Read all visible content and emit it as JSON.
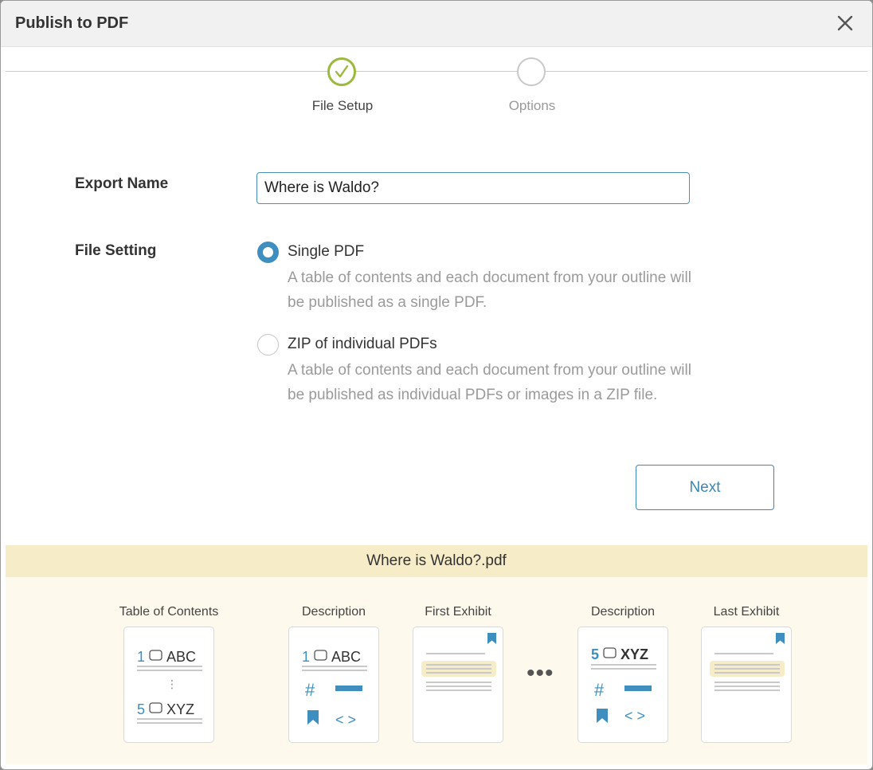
{
  "dialog": {
    "title": "Publish to PDF",
    "close_icon": "close-icon"
  },
  "stepper": {
    "steps": [
      {
        "label": "File Setup",
        "state": "completed"
      },
      {
        "label": "Options",
        "state": "pending"
      }
    ]
  },
  "form": {
    "export_name_label": "Export Name",
    "export_name_value": "Where is Waldo?",
    "file_setting_label": "File Setting",
    "options": [
      {
        "title": "Single PDF",
        "description": "A table of contents and each document from your outline will be published as a single PDF.",
        "selected": true
      },
      {
        "title": "ZIP of individual PDFs",
        "description": "A table of contents and each document from your outline will be published as individual PDFs or images in a ZIP file.",
        "selected": false
      }
    ],
    "next_label": "Next"
  },
  "preview": {
    "filename": "Where is Waldo?.pdf",
    "cards": [
      {
        "label": "Table of Contents",
        "line1_num": "1",
        "line1_text": "ABC",
        "line2_num": "5",
        "line2_text": "XYZ"
      },
      {
        "label": "Description",
        "num": "1",
        "text": "ABC"
      },
      {
        "label": "First Exhibit"
      },
      {
        "label": "Description",
        "num": "5",
        "text": "XYZ"
      },
      {
        "label": "Last Exhibit"
      }
    ],
    "ellipsis": "•••",
    "hash": "#",
    "code_glyph": "< >",
    "vdots": "⋮"
  },
  "colors": {
    "accent_blue": "#3e8fc0",
    "step_complete": "#9bb93b",
    "highlight": "#f6ecc8"
  }
}
